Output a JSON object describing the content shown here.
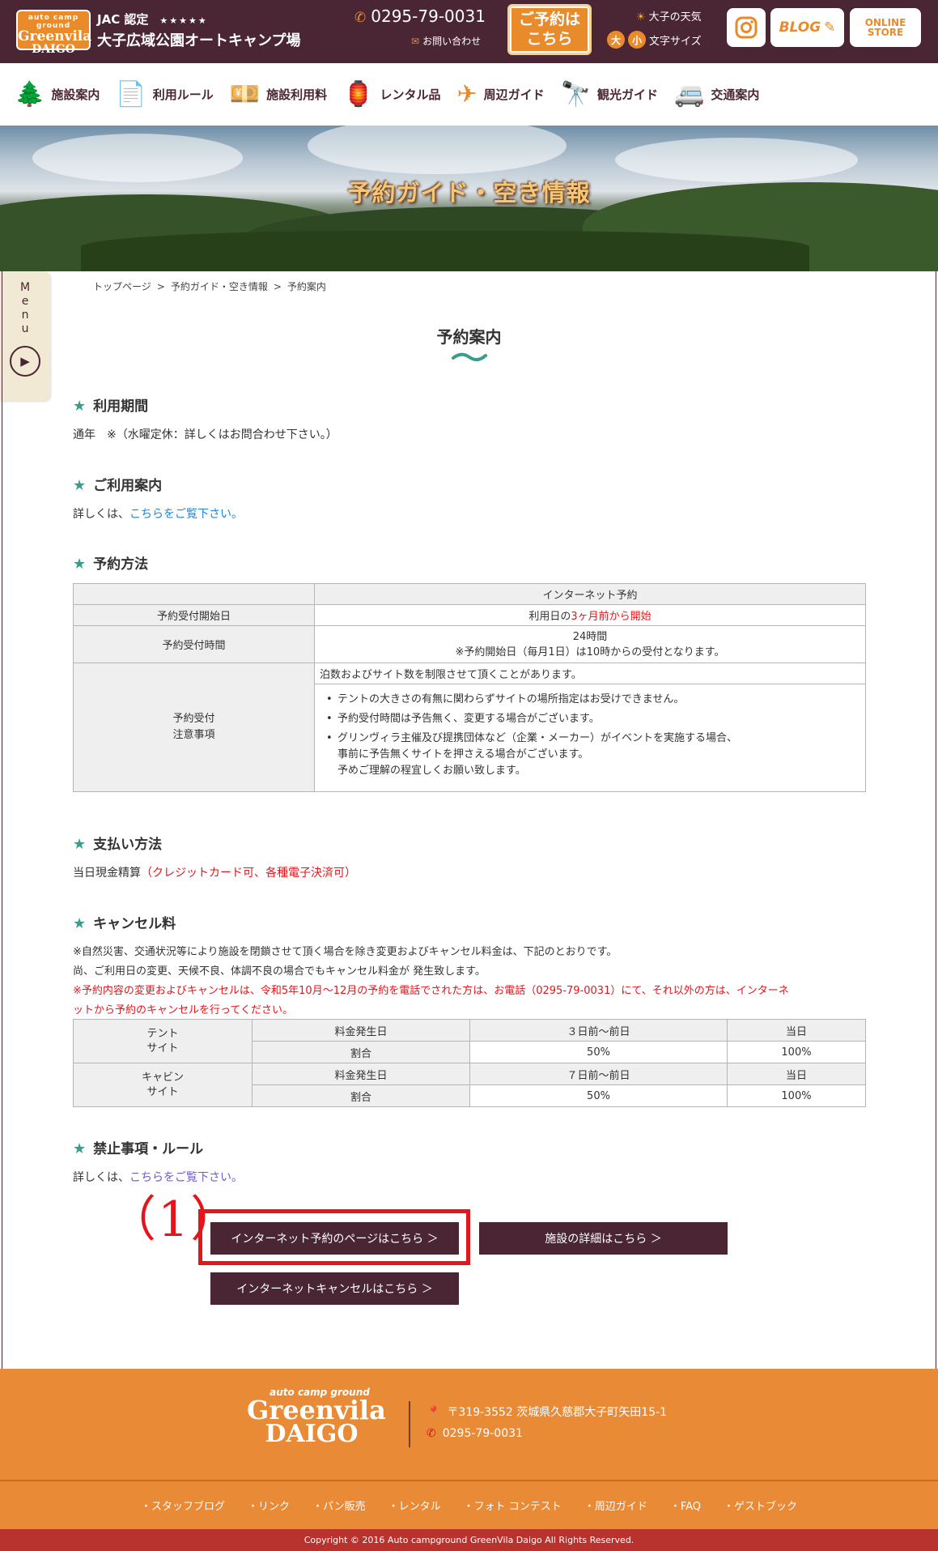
{
  "header": {
    "logo": {
      "line1": "auto camp ground",
      "line2": "Greenvila",
      "line3": "DAIGO"
    },
    "cert": "JAC 認定",
    "stars": "★★★★★",
    "site_name": "大子広域公園オートキャンプ場",
    "phone": "0295-79-0031",
    "contact": "お問い合わせ",
    "reserve_line1": "ご予約は",
    "reserve_line2": "こちら",
    "weather": "大子の天気",
    "fontsize_large": "大",
    "fontsize_small": "小",
    "fontsize_label": "文字サイズ",
    "blog": "BLOG",
    "store_line1": "ONLINE",
    "store_line2": "STORE"
  },
  "nav": [
    {
      "label": "施設案内",
      "icon": "tree-icon",
      "glyph": "🌲"
    },
    {
      "label": "利用ルール",
      "icon": "document-icon",
      "glyph": "📄"
    },
    {
      "label": "施設利用料",
      "icon": "money-icon",
      "glyph": "💴"
    },
    {
      "label": "レンタル品",
      "icon": "lantern-icon",
      "glyph": "🏮"
    },
    {
      "label": "周辺ガイド",
      "icon": "paper-plane-icon",
      "glyph": "✈"
    },
    {
      "label": "観光ガイド",
      "icon": "binoculars-icon",
      "glyph": "🔭"
    },
    {
      "label": "交通案内",
      "icon": "camper-icon",
      "glyph": "🚐"
    }
  ],
  "hero": {
    "title": "予約ガイド・空き情報"
  },
  "side_menu": {
    "label": "Menu"
  },
  "breadcrumb": [
    "トップページ",
    "予約ガイド・空き情報",
    "予約案内"
  ],
  "page_title": "予約案内",
  "sections": {
    "period": {
      "heading": "利用期間",
      "text": "通年　※（水曜定休：詳しくはお問合わせ下さい。）"
    },
    "usage": {
      "heading": "ご利用案内",
      "prefix": "詳しくは、",
      "link": "こちらをご覧下さい。"
    },
    "method": {
      "heading": "予約方法"
    },
    "payment": {
      "heading": "支払い方法",
      "text": "当日現金精算",
      "red": "（クレジットカード可、各種電子決済可）"
    },
    "cancel": {
      "heading": "キャンセル料",
      "line1": "※自然災害、交通状況等により施設を閉鎖させて頂く場合を除き変更およびキャンセル料金は、下記のとおりです。",
      "line2": "尚、ご利用日の変更、天候不良、体調不良の場合でもキャンセル料金が 発生致します。",
      "red1": "※予約内容の変更およびキャンセルは、令和5年10月～12月の予約を電話でされた方は、お電話（0295-79-0031）にて、それ以外の方は、インターネ",
      "red2": "ットから予約のキャンセルを行ってください。"
    },
    "rules": {
      "heading": "禁止事項・ルール",
      "prefix": "詳しくは、",
      "link": "こちらをご覧下さい。"
    }
  },
  "res_table": {
    "col_header": "インターネット予約",
    "row1_label": "予約受付開始日",
    "row1_prefix": "利用日の",
    "row1_red": "3ヶ月前から開始",
    "row2_label": "予約受付時間",
    "row2_line1": "24時間",
    "row2_line2": "※予約開始日（毎月1日）は10時からの受付となります。",
    "row3_label_line1": "予約受付",
    "row3_label_line2": "注意事項",
    "row3_note": "泊数およびサイト数を制限させて頂くことがあります。",
    "bullets": [
      "テントの大きさの有無に関わらずサイトの場所指定はお受けできません。",
      "予約受付時間は予告無く、変更する場合がございます。"
    ],
    "bullet3_line1": "グリンヴィラ主催及び提携団体など（企業・メーカー）がイベントを実施する場合、",
    "bullet3_line2": "事前に予告無くサイトを押さえる場合がございます。",
    "bullet3_line3": "予めご理解の程宜しくお願い致します。"
  },
  "cancel_table": {
    "tent_line1": "テント",
    "tent_line2": "サイト",
    "cabin_line1": "キャビン",
    "cabin_line2": "サイト",
    "fee_day": "料金発生日",
    "rate": "割合",
    "tent_day1": "３日前～前日",
    "cabin_day1": "７日前～前日",
    "same_day": "当日",
    "rate1": "50%",
    "rate2": "100%"
  },
  "buttons": {
    "internet_reserve": "インターネット予約のページはこちら ＞",
    "facility_detail": "施設の詳細はこちら ＞",
    "internet_cancel": "インターネットキャンセルはこちら ＞"
  },
  "annotation": {
    "label": "（1）"
  },
  "footer": {
    "logo_line1": "auto camp ground",
    "logo_line2": "Greenvila",
    "logo_line3": "DAIGO",
    "address": "〒319-3552 茨城県久慈郡大子町矢田15-1",
    "tel": "0295-79-0031",
    "links": [
      "・スタッフブログ",
      "・リンク",
      "・パン販売",
      "・レンタル",
      "・フォト コンテスト",
      "・周辺ガイド",
      "・FAQ",
      "・ゲストブック"
    ],
    "copyright": "Copyright © 2016 Auto campground GreenVila Daigo All Rights Reserved."
  },
  "colors": {
    "brand": "#4a2634",
    "accent": "#e98b2a",
    "teal": "#3a9d8c",
    "red": "#e4151b",
    "link": "#1a87d8"
  }
}
